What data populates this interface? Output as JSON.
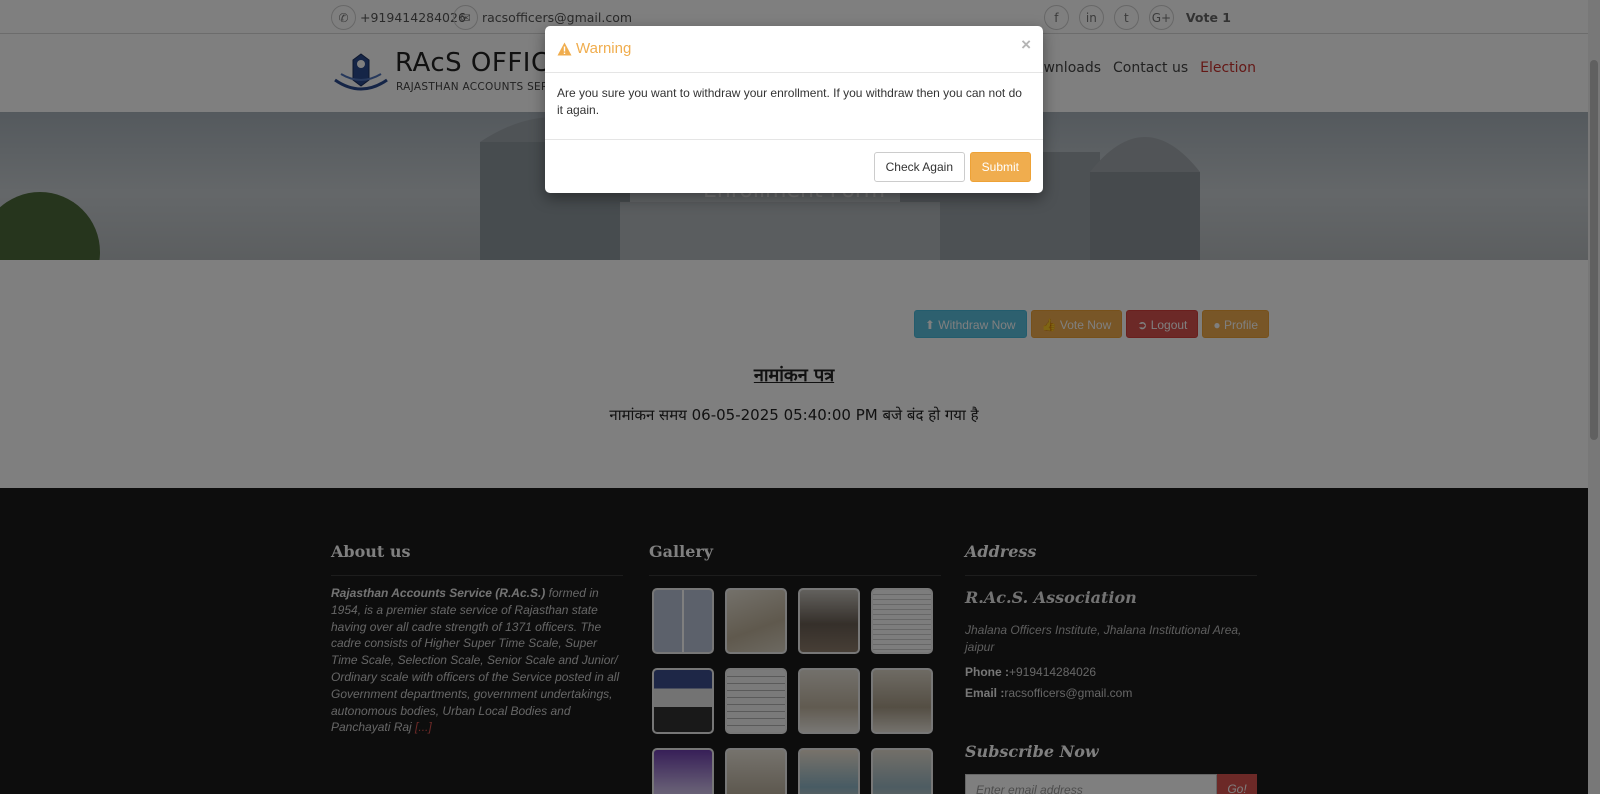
{
  "topbar": {
    "phone": "+919414284026",
    "email": "racsofficers@gmail.com",
    "social": [
      "f",
      "in",
      "t",
      "G+"
    ],
    "vote_label": "Vote 1"
  },
  "nav": {
    "brand_title": "RAcS OFFICE",
    "brand_sub": "RAJASTHAN ACCOUNTS SERVIC",
    "links": [
      "Downloads",
      "Contact us",
      "Election"
    ]
  },
  "banner": {
    "title": "Enrollment Form"
  },
  "actions": {
    "withdraw": "Withdraw Now",
    "vote": "Vote Now",
    "logout": "Logout",
    "profile": "Profile"
  },
  "main": {
    "heading": "नामांकन पत्र",
    "closed_message": "नामांकन समय 06-05-2025 05:40:00 PM बजे बंद हो गया है"
  },
  "footer": {
    "about": {
      "heading": "About us",
      "lead": "Rajasthan Accounts Service (R.Ac.S.)",
      "text": " formed in 1954, is a premier state service of Rajasthan state having over all cadre strength of 1371 officers. The cadre consists of Higher Super Time Scale, Super Time Scale, Selection Scale, Senior Scale and Junior/ Ordinary scale with officers of the Service posted in all Government departments, government undertakings, autonomous bodies, Urban Local Bodies and Panchayati Raj ",
      "more": "[...]"
    },
    "gallery": {
      "heading": "Gallery"
    },
    "address": {
      "heading": "Address",
      "org": "R.Ac.S. Association",
      "line": "Jhalana Officers Institute, Jhalana Institutional Area, jaipur",
      "phone_label": "Phone :",
      "phone": "+919414284026",
      "email_label": "Email :",
      "email": "racsofficers@gmail.com"
    },
    "subscribe": {
      "heading": "Subscribe Now",
      "placeholder": "Enter email address",
      "button": "Go!"
    }
  },
  "modal": {
    "title": "Warning",
    "close": "×",
    "body": "Are you sure you want to withdraw your enrollment. If you withdraw then you can not do it again.",
    "check_again": "Check Again",
    "submit": "Submit"
  },
  "colors": {
    "warning": "#f0ad4e",
    "info": "#5bc0de",
    "danger": "#d9534f",
    "footer_bg": "#1b1b1b"
  }
}
